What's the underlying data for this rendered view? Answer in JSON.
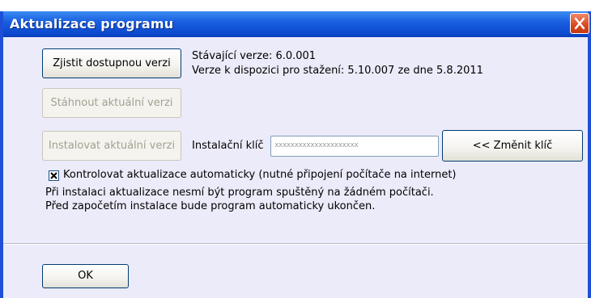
{
  "window": {
    "title": "Aktualizace programu"
  },
  "buttons": {
    "check_version": "Zjistit dostupnou verzi",
    "download": "Stáhnout aktuální verzi",
    "install": "Instalovat aktuální verzi",
    "change_key": "<< Změnit klíč",
    "ok": "OK"
  },
  "version_info": {
    "current": "Stávající verze: 6.0.001",
    "available": "Verze k dispozici pro stažení: 5.10.007 ze dne 5.8.2011"
  },
  "install_key": {
    "label": "Instalační klíč",
    "value": "xxxxxxxxxxxxxxxxxxxxx"
  },
  "auto_update": {
    "checked": true,
    "label": "Kontrolovat aktualizace automaticky (nutné připojení počítače na internet)"
  },
  "notes": {
    "line1": "Při instalaci aktualizace nesmí být program spuštěný na žádném počítači.",
    "line2": "Před započetím instalace bude program automaticky ukončen."
  },
  "colors": {
    "titlebar": "#0b4ad0",
    "window_bg": "#ecebfa",
    "close_button": "#d9481f"
  },
  "icons": {
    "close": "close-icon",
    "checkbox": "checkmark-icon"
  }
}
